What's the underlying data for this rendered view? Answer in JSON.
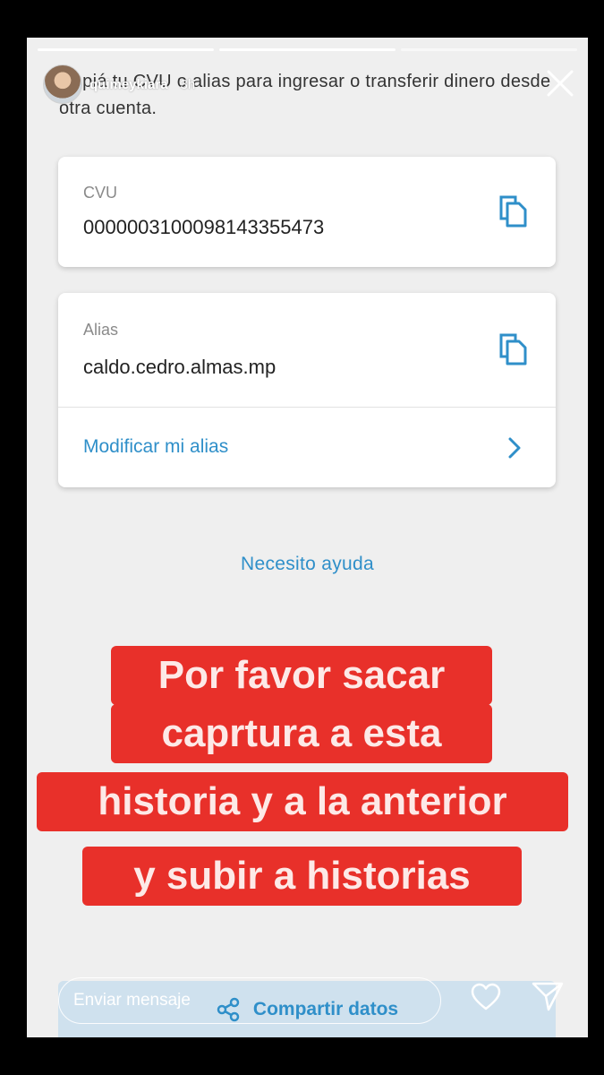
{
  "story": {
    "username": "quimeykiara",
    "time_ago": "3h",
    "progress": {
      "segments": 3,
      "current": 2
    }
  },
  "intro_text": "Copiá tu CVU o alias para ingresar o transferir dinero desde otra cuenta.",
  "cvu_card": {
    "label": "CVU",
    "value": "0000003100098143355473"
  },
  "alias_card": {
    "label": "Alias",
    "value": "caldo.cedro.almas.mp",
    "modify_link": "Modificar mi alias"
  },
  "help_link": "Necesito ayuda",
  "overlay_text": {
    "lines": [
      "Por favor sacar",
      "caprtura a esta",
      "historia y a la anterior",
      "y subir a historias"
    ]
  },
  "share": {
    "label": "Compartir datos"
  },
  "reply": {
    "placeholder": "Enviar mensaje"
  },
  "colors": {
    "accent": "#2f8fc9",
    "overlay_red": "#e8302a",
    "background": "#efefef"
  },
  "icons": [
    "close-icon",
    "copy-icon",
    "chevron-right-icon",
    "share-icon",
    "heart-icon",
    "send-icon"
  ]
}
